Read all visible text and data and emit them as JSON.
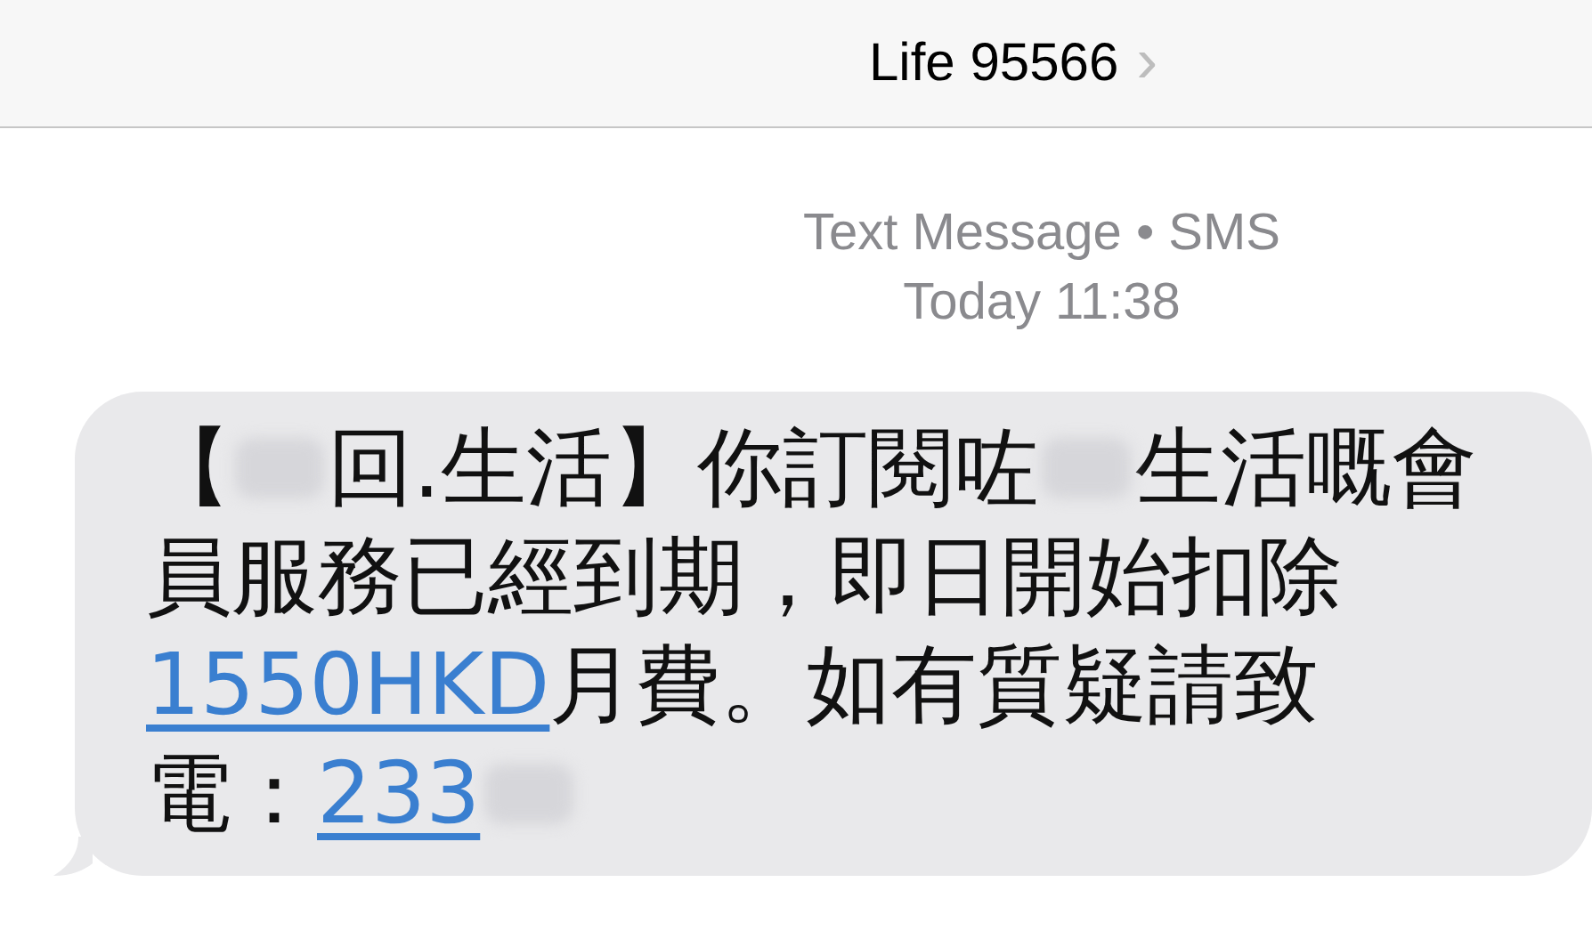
{
  "header": {
    "title": "Life 95566",
    "chevron": "›"
  },
  "meta": {
    "service": "Text Message • SMS",
    "time": "Today 11:38"
  },
  "message": {
    "lines": [
      [
        {
          "kind": "text",
          "text": "【"
        },
        {
          "kind": "redacted"
        },
        {
          "kind": "text",
          "text": "回.生活】你訂閱咗"
        },
        {
          "kind": "redacted"
        },
        {
          "kind": "text",
          "text": "生活嘅會"
        }
      ],
      [
        {
          "kind": "text",
          "text": "員服務已經到期，即日開始扣除"
        }
      ],
      [
        {
          "kind": "link",
          "text": "1550HKD "
        },
        {
          "kind": "text",
          "text": "月費。如有質疑請致"
        }
      ],
      [
        {
          "kind": "text",
          "text": "電："
        },
        {
          "kind": "link",
          "text": "233"
        },
        {
          "kind": "redacted"
        }
      ]
    ]
  }
}
